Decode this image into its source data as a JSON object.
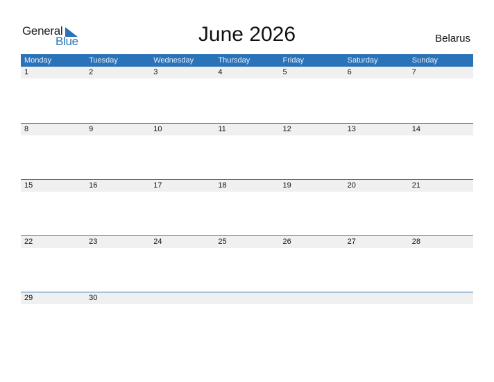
{
  "logo": {
    "word1": "General",
    "word2": "Blue",
    "accent": "#2b73b9"
  },
  "title": "June 2026",
  "country": "Belarus",
  "weekdays": [
    "Monday",
    "Tuesday",
    "Wednesday",
    "Thursday",
    "Friday",
    "Saturday",
    "Sunday"
  ],
  "weeks": [
    [
      "1",
      "2",
      "3",
      "4",
      "5",
      "6",
      "7"
    ],
    [
      "8",
      "9",
      "10",
      "11",
      "12",
      "13",
      "14"
    ],
    [
      "15",
      "16",
      "17",
      "18",
      "19",
      "20",
      "21"
    ],
    [
      "22",
      "23",
      "24",
      "25",
      "26",
      "27",
      "28"
    ],
    [
      "29",
      "30",
      "",
      "",
      "",
      "",
      ""
    ]
  ],
  "colors": {
    "header_bg": "#2b73b9",
    "row_strip": "#f0f0f0"
  }
}
